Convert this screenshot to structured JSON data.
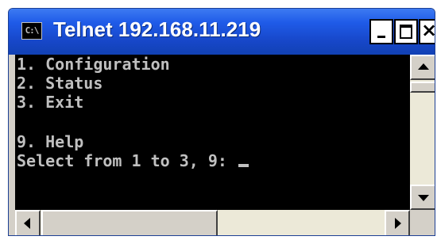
{
  "window": {
    "icon_label": "C:\\",
    "title": "Telnet 192.168.11.219",
    "controls": {
      "minimize": "minimize",
      "maximize": "maximize",
      "close": "×"
    }
  },
  "console": {
    "lines": [
      "1. Configuration",
      "2. Status",
      "3. Exit",
      "",
      "9. Help",
      "Select from 1 to 3, 9: "
    ],
    "text_color": "#c0c0c0",
    "background": "#000000"
  },
  "colors": {
    "titlebar": "#1f5be8",
    "chrome": "#d4d0c8"
  },
  "icons": {
    "app": "command-prompt-icon",
    "scroll_up": "triangle-up",
    "scroll_down": "triangle-down",
    "scroll_left": "triangle-left",
    "scroll_right": "triangle-right"
  }
}
